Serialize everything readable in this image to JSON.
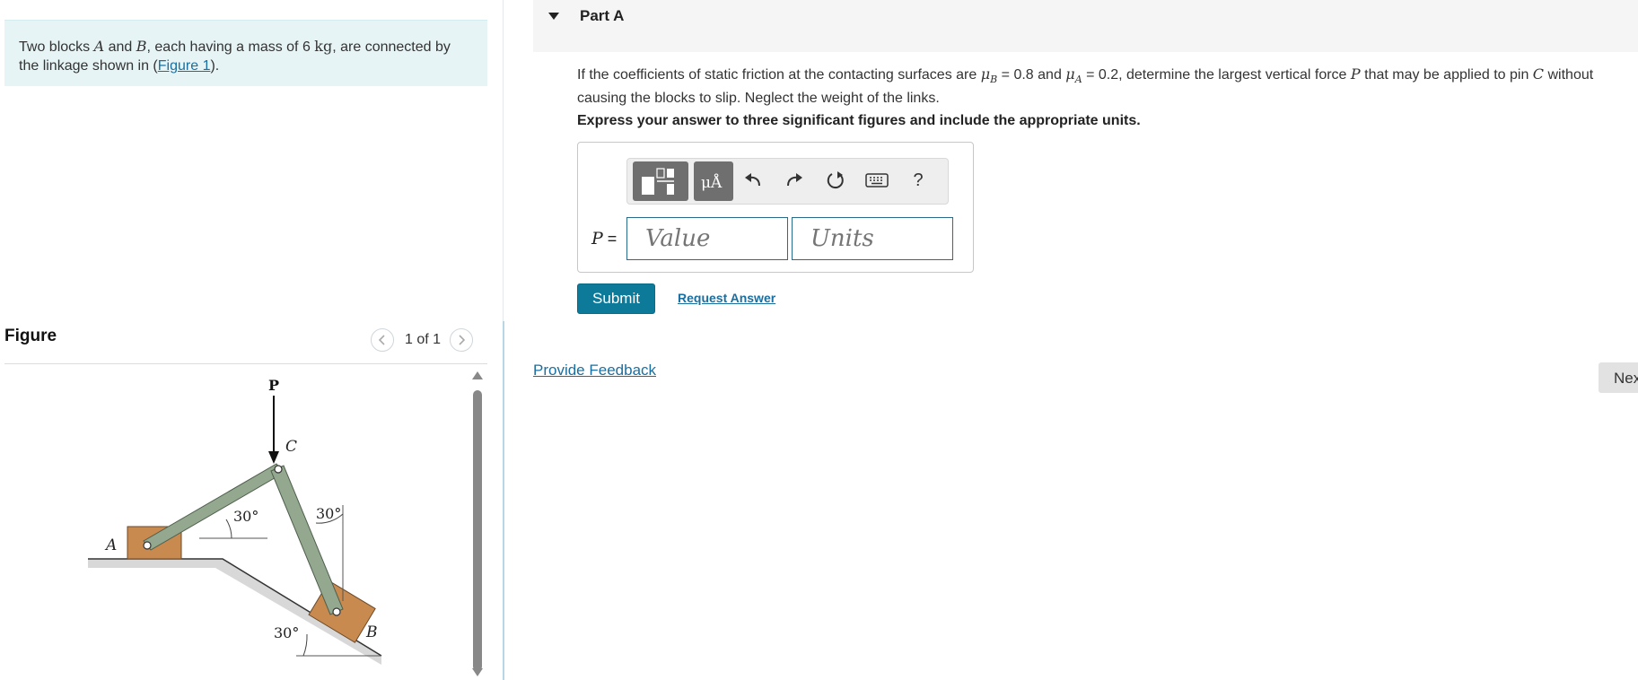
{
  "intro": {
    "t1": "Two blocks ",
    "varA": "A",
    "t2": " and ",
    "varB": "B",
    "t3": ", each having a mass of 6 ",
    "unit": "kg",
    "t4": ", are connected by the linkage shown in (",
    "figure_link": "Figure 1",
    "t5": ")."
  },
  "figure": {
    "title": "Figure",
    "pager_text": "1 of 1",
    "labels": {
      "P": "P",
      "C": "C",
      "A": "A",
      "B": "B",
      "angle_a": "30°",
      "angle_c": "30°",
      "angle_b": "30°"
    }
  },
  "part": {
    "title": "Part A"
  },
  "question": {
    "t1": "If the coefficients of static friction at the contacting surfaces are ",
    "mu": "μ",
    "subB": "B",
    "t2": " = 0.8 and ",
    "subA": "A",
    "t3": " = 0.2, determine the largest vertical force ",
    "varP": "P",
    "t4": " that may be applied to pin ",
    "varC": "C",
    "t5": " without causing the blocks to slip. Neglect the weight of the links."
  },
  "instruction": "Express your answer to three significant figures and include the appropriate units.",
  "answer": {
    "p_label": "P",
    "equals": " =",
    "value_placeholder": "Value",
    "units_placeholder": "Units",
    "units_button_text": "μÅ",
    "help_text": "?"
  },
  "submit_label": "Submit",
  "request_label": "Request Answer",
  "feedback_label": "Provide Feedback",
  "next_label": "Nex"
}
